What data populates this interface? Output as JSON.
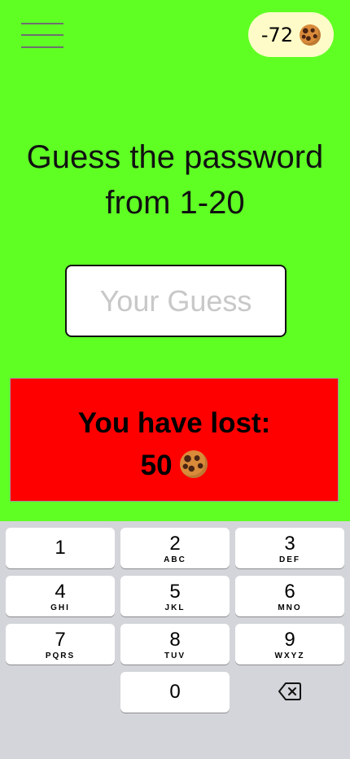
{
  "header": {
    "menu_icon": "hamburger-menu-icon",
    "cookie_count": "-72",
    "cookie_icon": "cookie-icon"
  },
  "main": {
    "title_line1": "Guess the password",
    "title_line2": "from 1-20",
    "input": {
      "value": "",
      "placeholder": "Your Guess"
    }
  },
  "result": {
    "line1": "You have lost:",
    "amount": "50",
    "icon": "cookie-icon",
    "background": "#ff0000"
  },
  "keyboard": {
    "keys": [
      {
        "digit": "1",
        "letters": ""
      },
      {
        "digit": "2",
        "letters": "ABC"
      },
      {
        "digit": "3",
        "letters": "DEF"
      },
      {
        "digit": "4",
        "letters": "GHI"
      },
      {
        "digit": "5",
        "letters": "JKL"
      },
      {
        "digit": "6",
        "letters": "MNO"
      },
      {
        "digit": "7",
        "letters": "PQRS"
      },
      {
        "digit": "8",
        "letters": "TUV"
      },
      {
        "digit": "9",
        "letters": "WXYZ"
      },
      {
        "digit": "0",
        "letters": ""
      }
    ],
    "backspace_icon": "backspace-icon"
  },
  "colors": {
    "background": "#5fff24",
    "cookie_pill": "#fffbc8",
    "result": "#ff0000",
    "keyboard": "#d4d5da"
  }
}
